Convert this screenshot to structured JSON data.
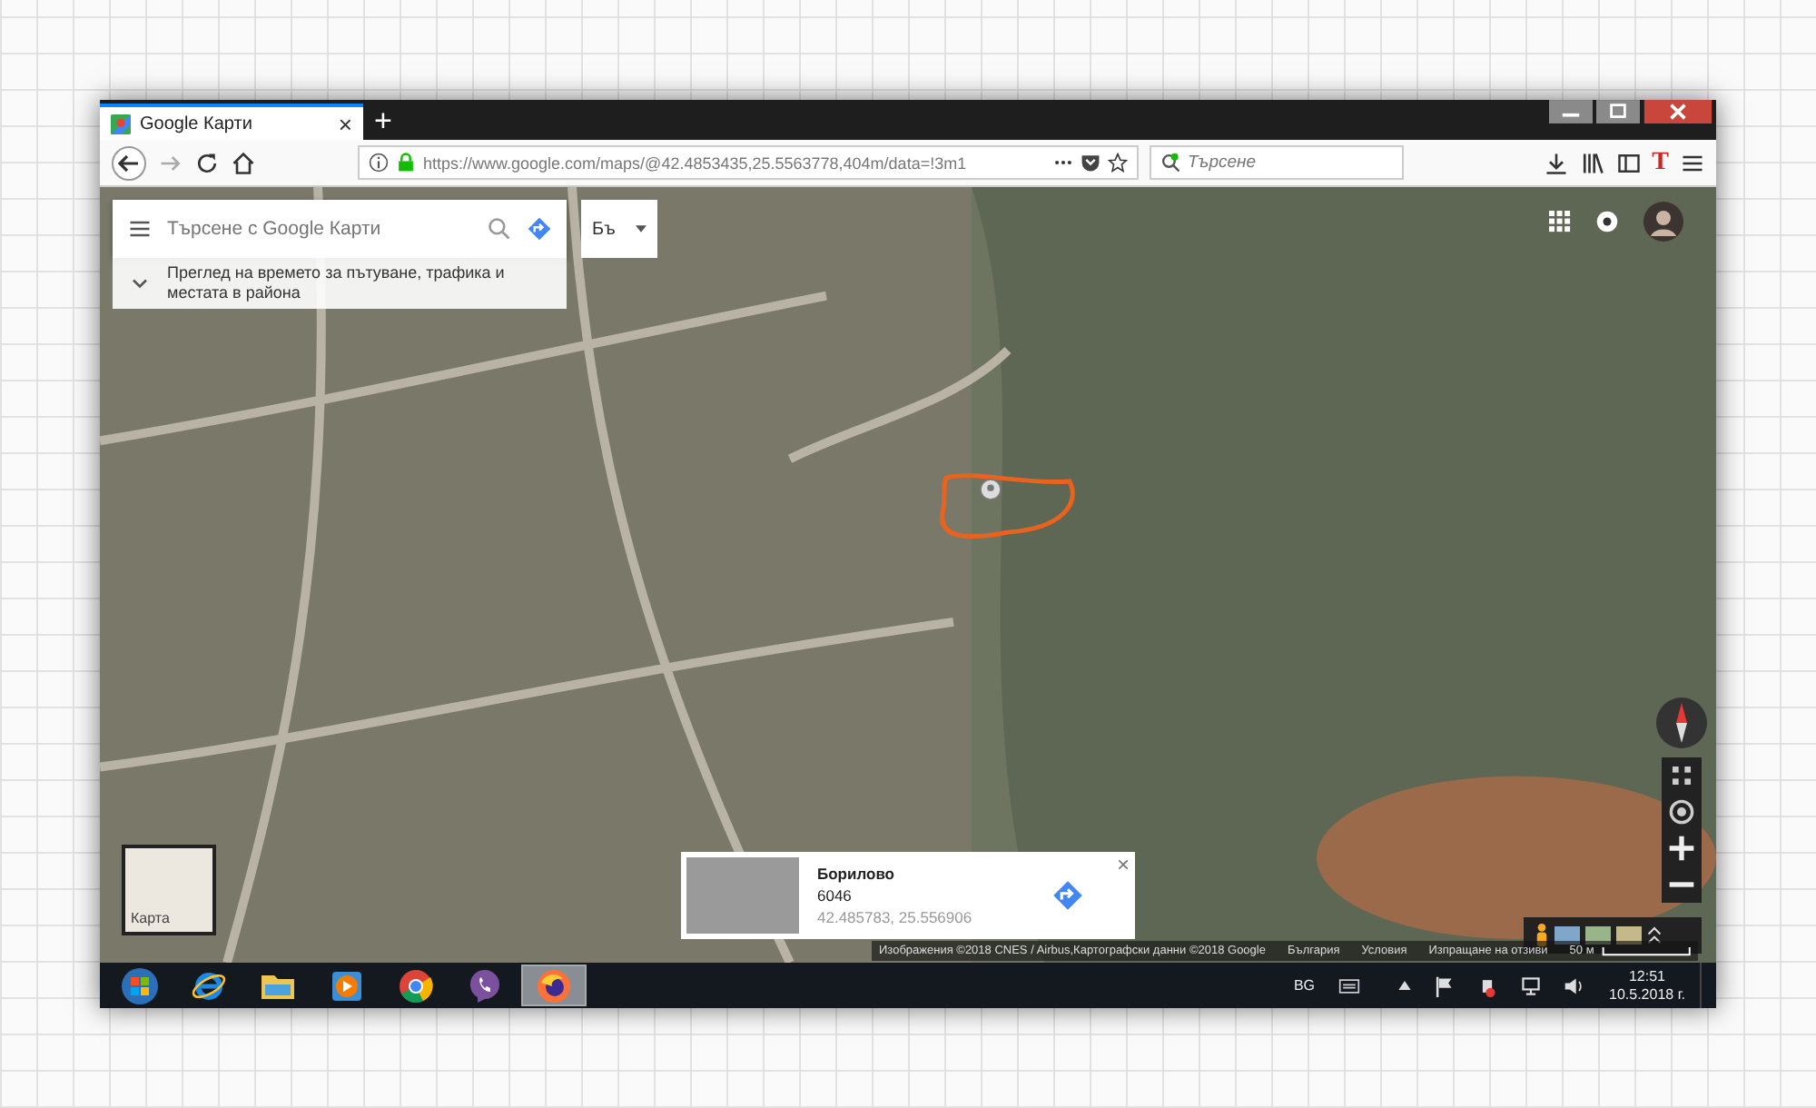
{
  "browser": {
    "tabs": [
      {
        "title": "Google Карти",
        "close": "×",
        "selected": true
      }
    ],
    "new_tab": "+",
    "url": "https://www.google.com/maps/@42.4853435,25.5563778,404m/data=!3m1",
    "search": {
      "placeholder": "Търсене"
    },
    "extension_label": "T"
  },
  "maps": {
    "search": {
      "placeholder": "Търсене с Google Карти"
    },
    "language": "Бъ",
    "explore_hint": "Преглед на времето за пътуване, трафика и местата в района",
    "layer_toggle": {
      "label": "Карта"
    },
    "place_card": {
      "name": "Борилово",
      "postal_code": "6046",
      "coordinates": "42.485783, 25.556906",
      "close": "×"
    },
    "footer": [
      "Изображения ©2018 CNES / Airbus,Картографски данни ©2018 Google",
      "България",
      "Условия",
      "Изпращане на отзиви"
    ],
    "scale": "50 м"
  },
  "taskbar": {
    "apps": [
      {
        "kind": "start",
        "selected": false
      },
      {
        "kind": "ie",
        "selected": false
      },
      {
        "kind": "explorer",
        "selected": false
      },
      {
        "kind": "media",
        "selected": false
      },
      {
        "kind": "chrome",
        "selected": false
      },
      {
        "kind": "viber",
        "selected": false
      },
      {
        "kind": "firefox",
        "selected": true
      }
    ],
    "language": "BG",
    "time": "12:51",
    "date": "10.5.2018 г."
  }
}
